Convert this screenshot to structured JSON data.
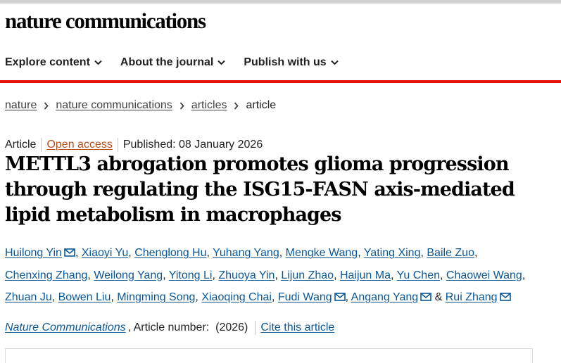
{
  "site": {
    "brand": "nature communications"
  },
  "nav": {
    "items": [
      {
        "label": "Explore content"
      },
      {
        "label": "About the journal"
      },
      {
        "label": "Publish with us"
      }
    ]
  },
  "breadcrumb": {
    "items": [
      "nature",
      "nature communications",
      "articles"
    ],
    "current": "article"
  },
  "article": {
    "type": "Article",
    "access": "Open access",
    "published": "Published: 08 January 2026",
    "title": "METTL3 abrogation promotes glioma progression through regulating the ISG15-FASN axis-mediated lipid metabolism in macrophages",
    "authors": [
      {
        "name": "Huilong Yin",
        "email": true
      },
      {
        "name": "Xiaoyi Yu",
        "email": false
      },
      {
        "name": "Chenglong Hu",
        "email": false
      },
      {
        "name": "Yuhang Yang",
        "email": false
      },
      {
        "name": "Mengke Wang",
        "email": false
      },
      {
        "name": "Yating Xing",
        "email": false
      },
      {
        "name": "Baile Zuo",
        "email": false
      },
      {
        "name": "Chenxing Zhang",
        "email": false
      },
      {
        "name": "Weilong Yang",
        "email": false
      },
      {
        "name": "Yitong Li",
        "email": false
      },
      {
        "name": "Zhuoya Yin",
        "email": false
      },
      {
        "name": "Lijun Zhao",
        "email": false
      },
      {
        "name": "Haijun Ma",
        "email": false
      },
      {
        "name": "Yu Chen",
        "email": false
      },
      {
        "name": "Chaowei Wang",
        "email": false
      },
      {
        "name": "Zhuan Ju",
        "email": false
      },
      {
        "name": "Bowen Liu",
        "email": false
      },
      {
        "name": "Mingming Song",
        "email": false
      },
      {
        "name": "Xiaoqing Chai",
        "email": false
      },
      {
        "name": "Fudi Wang",
        "email": true
      },
      {
        "name": "Angang Yang",
        "email": true
      },
      {
        "name": "Rui Zhang",
        "email": true
      }
    ],
    "author_separator": ",",
    "final_conjunction": "&"
  },
  "citation": {
    "journal": "Nature Communications",
    "details": ", Article number:  (2026)",
    "cite_label": "Cite this article"
  },
  "colors": {
    "accent_red": "#e3120b",
    "link_blue": "#0b5895",
    "open_access_orange": "#b4501f"
  }
}
